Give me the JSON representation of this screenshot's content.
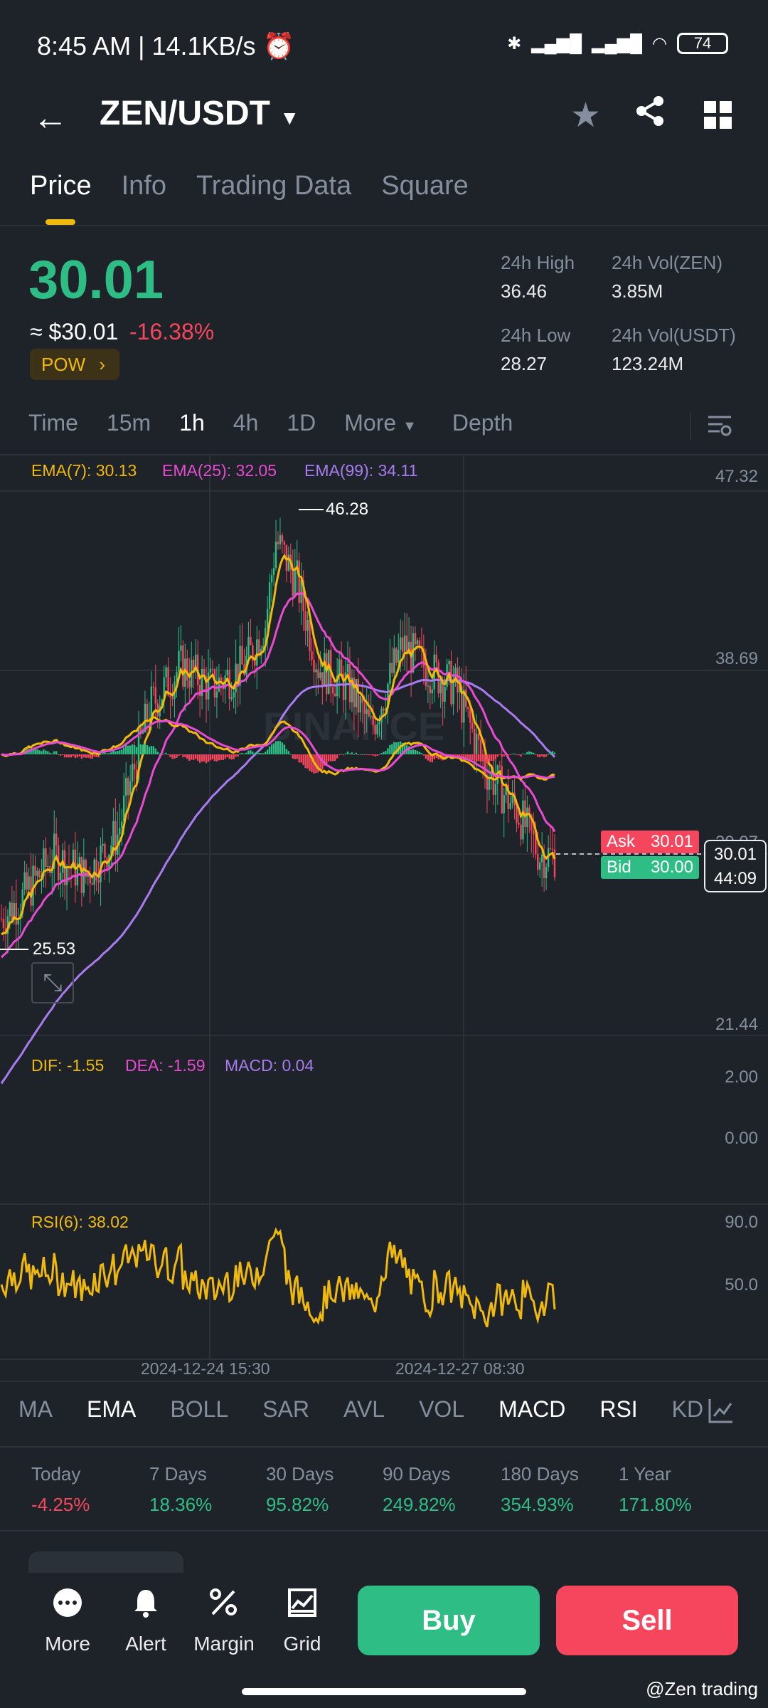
{
  "status_bar": {
    "time": "8:45 AM",
    "speed": "| 14.1KB/s",
    "battery": "74"
  },
  "header": {
    "pair": "ZEN/USDT"
  },
  "tabs": [
    "Price",
    "Info",
    "Trading Data",
    "Square"
  ],
  "summary": {
    "price": "30.01",
    "usd_price": "≈ $30.01",
    "change": "-16.38%",
    "tag": "POW",
    "high_label": "24h High",
    "high_value": "36.46",
    "low_label": "24h Low",
    "low_value": "28.27",
    "vol_zen_label": "24h Vol(ZEN)",
    "vol_zen_value": "3.85M",
    "vol_usdt_label": "24h Vol(USDT)",
    "vol_usdt_value": "123.24M"
  },
  "timeframes": {
    "items": [
      "Time",
      "15m",
      "1h",
      "4h",
      "1D",
      "More"
    ],
    "active": "1h",
    "depth": "Depth"
  },
  "main_chart": {
    "ema7": "EMA(7): 30.13",
    "ema25": "EMA(25): 32.05",
    "ema99": "EMA(99): 34.11",
    "y_ticks": [
      "47.32",
      "38.69",
      "30.07",
      "21.44"
    ],
    "high_marker": "46.28",
    "low_marker": "25.53",
    "ask_label": "Ask",
    "ask_value": "30.01",
    "bid_label": "Bid",
    "bid_value": "30.00",
    "last_price": "30.01",
    "countdown": "44:09",
    "watermark": "BINANCE"
  },
  "macd": {
    "dif": "DIF: -1.55",
    "dea": "DEA: -1.59",
    "macd": "MACD: 0.04",
    "y_ticks": [
      "2.00",
      "0.00"
    ]
  },
  "rsi": {
    "label": "RSI(6): 38.02",
    "y_ticks": [
      "90.0",
      "50.0"
    ]
  },
  "x_axis": [
    "2024-12-24 15:30",
    "2024-12-27 08:30"
  ],
  "indicators": {
    "items": [
      "MA",
      "EMA",
      "BOLL",
      "SAR",
      "AVL",
      "VOL",
      "MACD",
      "RSI",
      "KD"
    ]
  },
  "performance": [
    {
      "label": "Today",
      "value": "-4.25%"
    },
    {
      "label": "7 Days",
      "value": "18.36%"
    },
    {
      "label": "30 Days",
      "value": "95.82%"
    },
    {
      "label": "90 Days",
      "value": "249.82%"
    },
    {
      "label": "180 Days",
      "value": "354.93%"
    },
    {
      "label": "1 Year",
      "value": "171.80%"
    }
  ],
  "bottom_nav": {
    "more": "More",
    "alert": "Alert",
    "margin": "Margin",
    "grid": "Grid",
    "buy": "Buy",
    "sell": "Sell",
    "watermark": "@Zen trading"
  },
  "colors": {
    "up": "#2ebd85",
    "down": "#f6465d",
    "ema7": "#f0b90b",
    "ema25": "#e84bd2",
    "ema99": "#a87cf0"
  }
}
